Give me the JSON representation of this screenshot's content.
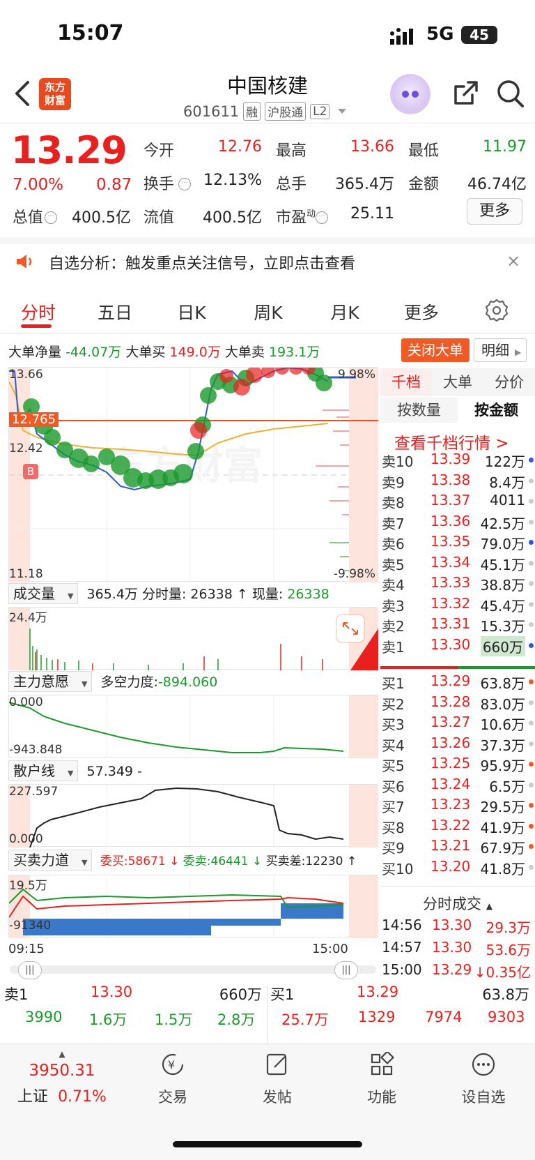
{
  "status": {
    "time": "15:07",
    "network": "5G",
    "battery": "45"
  },
  "header": {
    "logo_line1": "东方",
    "logo_line2": "财富",
    "name": "中国核建",
    "code": "601611",
    "tags": [
      "融",
      "沪股通",
      "L2"
    ]
  },
  "quote": {
    "price": "13.29",
    "pct": "7.00%",
    "change": "0.87",
    "open_label": "今开",
    "open": "12.76",
    "high_label": "最高",
    "high": "13.66",
    "low_label": "最低",
    "low": "11.97",
    "turnover_label": "换手",
    "turnover": "12.13%",
    "volume_label": "总手",
    "volume": "365.4万",
    "amount_label": "金额",
    "amount": "46.74亿",
    "mktcap_label": "总值",
    "mktcap": "400.5亿",
    "float_label": "流值",
    "float": "400.5亿",
    "pe_label": "市盈",
    "pe_sup": "动",
    "pe": "25.11",
    "more": "更多"
  },
  "notice": {
    "text": "自选分析：触发重点关注信号，立即点击查看",
    "close": "×"
  },
  "tabs": [
    "分时",
    "五日",
    "日K",
    "周K",
    "月K",
    "更多"
  ],
  "bigorder": {
    "net_label": "大单净量",
    "net": "-44.07万",
    "buy_label": "大单买",
    "buy": "149.0万",
    "sell_label": "大单卖",
    "sell": "193.1万",
    "close_btn": "关闭大单",
    "detail_btn": "明细"
  },
  "main_chart": {
    "top_left": "13.66",
    "top_right": "9.98%",
    "mid": "12.765",
    "prev": "12.42",
    "bottom_left": "11.18",
    "bottom_right": "-9.98%",
    "b_marker": "B"
  },
  "volume_panel": {
    "selector": "成交量",
    "info1": "365.4万",
    "info2_label": "分时量:",
    "info2": "26338",
    "info3_label": "现量:",
    "info3": "26338",
    "axis_top": "24.4万"
  },
  "main_force": {
    "selector": "主力意愿",
    "info_label": "多空力度:",
    "info": "-894.060",
    "axis_top": "0.000",
    "axis_bottom": "-943.848"
  },
  "retail": {
    "selector": "散户线",
    "info": "57.349 -",
    "axis_top": "227.597",
    "axis_bottom": "0.000"
  },
  "force": {
    "selector": "买卖力道",
    "buy_label": "委买:",
    "buy": "58671",
    "sell_label": "委卖:",
    "sell": "46441",
    "diff_label": "买卖差:",
    "diff": "12230",
    "axis_top": "19.5万",
    "axis_bottom": "-91340"
  },
  "time_axis": {
    "start": "09:15",
    "end": "15:00"
  },
  "orderbook": {
    "tabs": [
      "千档",
      "大单",
      "分价"
    ],
    "subtabs": [
      "按数量",
      "按金额"
    ],
    "link": "查看千档行情 >",
    "asks": [
      {
        "label": "卖10",
        "price": "13.39",
        "vol": "122万",
        "dot": "#2d5bd6"
      },
      {
        "label": "卖9",
        "price": "13.38",
        "vol": "8.4万",
        "dot": "#ccc"
      },
      {
        "label": "卖8",
        "price": "13.37",
        "vol": "4011",
        "dot": "#ccc"
      },
      {
        "label": "卖7",
        "price": "13.36",
        "vol": "42.5万",
        "dot": "#ccc"
      },
      {
        "label": "卖6",
        "price": "13.35",
        "vol": "79.0万",
        "dot": "#2d5bd6"
      },
      {
        "label": "卖5",
        "price": "13.34",
        "vol": "45.1万",
        "dot": "#ccc"
      },
      {
        "label": "卖4",
        "price": "13.33",
        "vol": "38.8万",
        "dot": "#ccc"
      },
      {
        "label": "卖3",
        "price": "13.32",
        "vol": "45.4万",
        "dot": "#ccc"
      },
      {
        "label": "卖2",
        "price": "13.31",
        "vol": "15.3万",
        "dot": "#ccc"
      },
      {
        "label": "卖1",
        "price": "13.30",
        "vol": "660万",
        "dot": "#2d5bd6"
      }
    ],
    "bids": [
      {
        "label": "买1",
        "price": "13.29",
        "vol": "63.8万",
        "dot": "#f05a24"
      },
      {
        "label": "买2",
        "price": "13.28",
        "vol": "83.0万",
        "dot": "#ccc"
      },
      {
        "label": "买3",
        "price": "13.27",
        "vol": "10.6万",
        "dot": "#ccc"
      },
      {
        "label": "买4",
        "price": "13.26",
        "vol": "37.3万",
        "dot": "#ccc"
      },
      {
        "label": "买5",
        "price": "13.25",
        "vol": "95.9万",
        "dot": "#f05a24"
      },
      {
        "label": "买6",
        "price": "13.24",
        "vol": "6.5万",
        "dot": "#ccc"
      },
      {
        "label": "买7",
        "price": "13.23",
        "vol": "29.5万",
        "dot": "#f05a24"
      },
      {
        "label": "买8",
        "price": "13.22",
        "vol": "41.9万",
        "dot": "#f05a24"
      },
      {
        "label": "买9",
        "price": "13.21",
        "vol": "67.9万",
        "dot": "#f05a24"
      },
      {
        "label": "买10",
        "price": "13.20",
        "vol": "41.8万",
        "dot": "#ccc"
      }
    ],
    "trades_title": "分时成交",
    "trades": [
      {
        "time": "14:56",
        "price": "13.30",
        "vol": "29.3万"
      },
      {
        "time": "14:57",
        "price": "13.30",
        "vol": "53.6万"
      },
      {
        "time": "15:00",
        "price": "13.29",
        "vol": "↓0.35亿"
      }
    ]
  },
  "bottom_quotes": {
    "sell_label": "卖1",
    "sell_price": "13.30",
    "sell_vol": "660万",
    "buy_label": "买1",
    "buy_price": "13.29",
    "buy_vol": "63.8万",
    "left_vals": [
      "3990",
      "1.6万",
      "1.5万",
      "2.8万"
    ],
    "right_vals": [
      "25.7万",
      "1329",
      "7974",
      "9303"
    ]
  },
  "footer": {
    "index_value": "3950.31",
    "index_name": "上证",
    "index_pct": "0.71%",
    "items": [
      "交易",
      "发帖",
      "功能",
      "设自选"
    ]
  }
}
